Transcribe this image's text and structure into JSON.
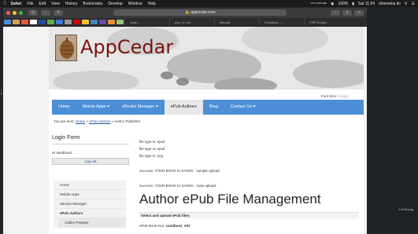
{
  "menubar": {
    "items": [
      "Safari",
      "File",
      "Edit",
      "View",
      "History",
      "Bookmarks",
      "Develop",
      "Window",
      "Help"
    ],
    "network": "12°C 1265 kB/s",
    "battery": "100%",
    "clock": "Sat 11:54",
    "user": "chiemeka ilo"
  },
  "browser": {
    "url": "appcedar.com",
    "tabs": [
      "zuser...",
      "php - if I wi...",
      "Manual",
      "Functions -...",
      "PHP Output..."
    ]
  },
  "desktop": {
    "left_file": "L.e",
    "right_file": "1 6.09.png"
  },
  "site": {
    "logo": "AppCedar",
    "font_size_label": "Font Size:",
    "font_size_controls": "+ | ± | -",
    "nav": [
      {
        "label": "Home"
      },
      {
        "label": "Mobile Apps"
      },
      {
        "label": "eBooks Manager"
      },
      {
        "label": "ePub Authors"
      },
      {
        "label": "Blog"
      },
      {
        "label": "Contact Us"
      }
    ],
    "breadcrumb": {
      "prefix": "You are here:",
      "home": "Home",
      "epub": "ePub Authors",
      "current": "Author Publisher"
    },
    "login": {
      "title": "Login Form",
      "greeting": "Hi sandbox2,",
      "logout": "Log out"
    },
    "sidebar_menu": [
      "Home",
      "Mobile Apps",
      "eBooks Manager",
      "ePub Authors",
      "Author Prepare"
    ],
    "main": {
      "file_types": [
        "file type is: epub",
        "file type is: epub",
        "file type is: png"
      ],
      "success_sample": "Success: YOUR BOOK IS SAVED - sample upload.",
      "success_main": "Success: YOUR BOOK IS SAVED - main upload.",
      "heading": "Author ePub File Management",
      "select_label": "Select and upload ePub files:",
      "book_key_label": "ePub Book Key:",
      "book_key_value": "sandbox2_001"
    }
  },
  "colors": {
    "nav_blue": "#4c8fd6",
    "logo_red": "#7a1410",
    "link_blue": "#1d4e9e"
  }
}
